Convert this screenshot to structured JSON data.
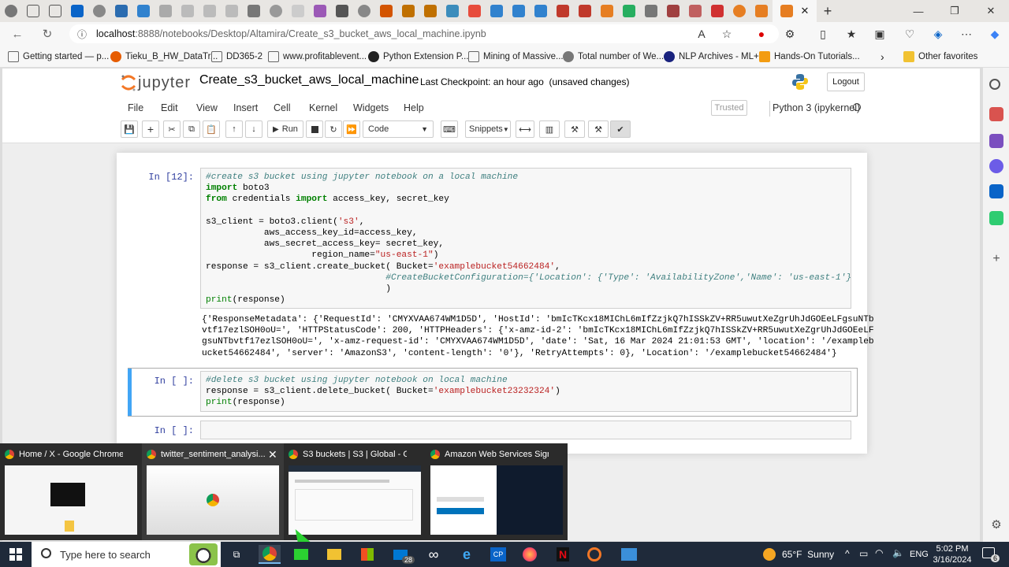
{
  "browser": {
    "url_host": "localhost",
    "url_path": ":8888/notebooks/Desktop/Altamira/Create_s3_bucket_aws_local_machine.ipynb",
    "bookmarks": [
      "Getting started — p...",
      "Tieku_B_HW_DataTr...",
      "DD365-2",
      "www.profitablevent...",
      "Python Extension P...",
      "Mining of Massive...",
      "Total number of We...",
      "NLP Archives - ML+",
      "Hands-On Tutorials...",
      "Other favorites"
    ]
  },
  "jupyter": {
    "logo_text": "jupyter",
    "notebook_title": "Create_s3_bucket_aws_local_machine",
    "checkpoint": "Last Checkpoint: an hour ago",
    "unsaved": "(unsaved changes)",
    "logout": "Logout",
    "menu": [
      "File",
      "Edit",
      "View",
      "Insert",
      "Cell",
      "Kernel",
      "Widgets",
      "Help"
    ],
    "trusted": "Trusted",
    "kernel": "Python 3 (ipykernel)",
    "toolbar": {
      "run_label": "Run",
      "cell_type": "Code",
      "snippets": "Snippets"
    }
  },
  "cells": {
    "c1_prompt": "In [12]:",
    "c2_prompt": "In [ ]:",
    "c3_prompt": "In [ ]:",
    "c1_output": "{'ResponseMetadata': {'RequestId': 'CMYXVAA674WM1D5D', 'HostId': 'bmIcTKcx18MIChL6mIfZzjkQ7hISSkZV+RR5uwutXeZgrUhJdGOEeLFgsuNTb\nvtf17ezlSOH0oU=', 'HTTPStatusCode': 200, 'HTTPHeaders': {'x-amz-id-2': 'bmIcTKcx18MIChL6mIfZzjkQ7hISSkZV+RR5uwutXeZgrUhJdGOEeLF\ngsuNTbvtf17ezlSOH0oU=', 'x-amz-request-id': 'CMYXVAA674WM1D5D', 'date': 'Sat, 16 Mar 2024 21:01:53 GMT', 'location': '/exampleb\nucket54662484', 'server': 'AmazonS3', 'content-length': '0'}, 'RetryAttempts': 0}, 'Location': '/examplebucket54662484'}"
  },
  "thumbnails": [
    "Home / X - Google Chrome",
    "twitter_sentiment_analysi...",
    "S3 buckets | S3 | Global - Googl...",
    "Amazon Web Services Sign-In -..."
  ],
  "taskbar": {
    "search_placeholder": "Type here to search",
    "mail_badge": "28",
    "weather": "65°F  Sunny",
    "lang": "ENG",
    "time": "5:02 PM",
    "date": "3/16/2024",
    "notif_count": "6"
  },
  "colors": {
    "accent_blue": "#42a5f5",
    "prompt_blue": "#303f9f",
    "taskbar_bg": "#1f2a3a"
  }
}
